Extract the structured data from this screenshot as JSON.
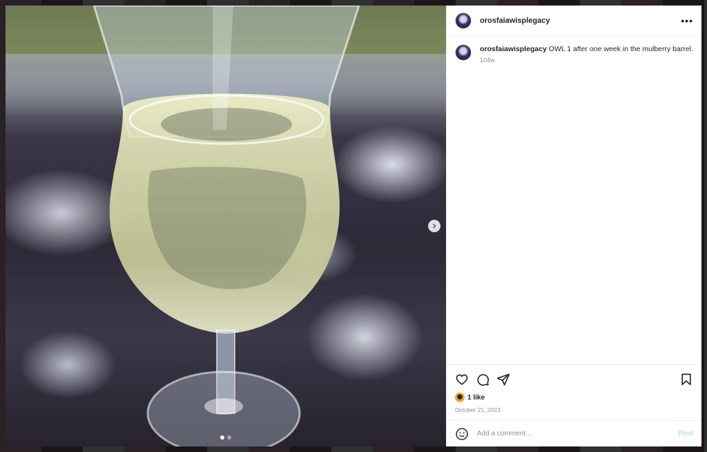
{
  "post": {
    "username": "orosfaiawisplegacy",
    "more_label": "•••",
    "caption": {
      "username": "orosfaiawisplegacy",
      "text": " OWL 1 after one week in the mulberry barrel.",
      "time_ago": "104w"
    },
    "likes": "1 like",
    "date": "October 21, 2023",
    "comment": {
      "placeholder": "Add a comment...",
      "post_label": "Post"
    },
    "media": {
      "slides": 2,
      "current_slide": 1
    }
  },
  "icons": {
    "like": "heart-icon",
    "comment": "comment-icon",
    "share": "share-icon",
    "save": "bookmark-icon",
    "emoji": "emoji-icon",
    "next": "chevron-right-icon"
  },
  "colors": {
    "post_button": "#b2dffc",
    "text_primary": "#262626",
    "text_secondary": "#8e8e8e"
  }
}
